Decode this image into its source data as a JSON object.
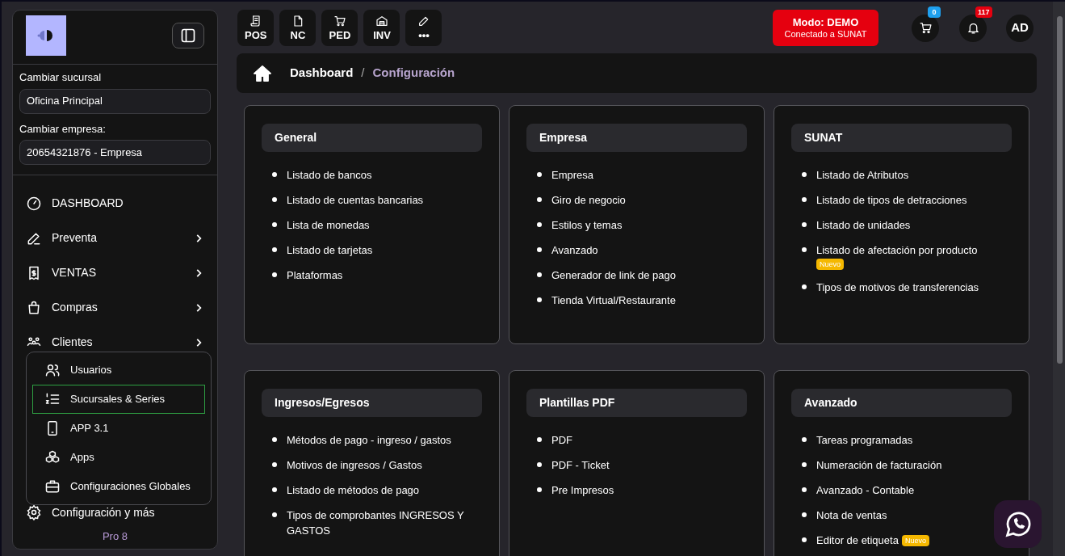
{
  "sidebar": {
    "sucursal_label": "Cambiar sucursal",
    "sucursal_value": "Oficina Principal",
    "empresa_label": "Cambiar empresa:",
    "empresa_value": "20654321876 - Empresa",
    "menu": [
      {
        "label": "DASHBOARD",
        "has_submenu": false
      },
      {
        "label": "Preventa",
        "has_submenu": true
      },
      {
        "label": "VENTAS",
        "has_submenu": true
      },
      {
        "label": "Compras",
        "has_submenu": true
      },
      {
        "label": "Clientes",
        "has_submenu": true
      }
    ],
    "submenu": [
      {
        "label": "Usuarios",
        "selected": false
      },
      {
        "label": "Sucursales & Series",
        "selected": true
      },
      {
        "label": "APP 3.1",
        "selected": false
      },
      {
        "label": "Apps",
        "selected": false
      },
      {
        "label": "Configuraciones Globales",
        "selected": false
      }
    ],
    "settings_item": "Configuración y más",
    "version": "Pro 8"
  },
  "toolbar": [
    {
      "label": "POS"
    },
    {
      "label": "NC"
    },
    {
      "label": "PED"
    },
    {
      "label": "INV"
    },
    {
      "label": "•••"
    }
  ],
  "mode_badge": {
    "title": "Modo: DEMO",
    "subtitle": "Conectado a SUNAT"
  },
  "cart_count": "0",
  "notification_count": "117",
  "avatar": "AD",
  "breadcrumb": [
    "Dashboard",
    "Configuración"
  ],
  "breadcrumb_separator": "/",
  "cards": [
    {
      "title": "General",
      "items": [
        {
          "text": "Listado de bancos"
        },
        {
          "text": "Listado de cuentas bancarias"
        },
        {
          "text": "Lista de monedas"
        },
        {
          "text": "Listado de tarjetas"
        },
        {
          "text": "Plataformas"
        }
      ]
    },
    {
      "title": "Empresa",
      "items": [
        {
          "text": "Empresa"
        },
        {
          "text": "Giro de negocio"
        },
        {
          "text": "Estilos y temas"
        },
        {
          "text": "Avanzado"
        },
        {
          "text": "Generador de link de pago"
        },
        {
          "text": "Tienda Virtual/Restaurante"
        }
      ]
    },
    {
      "title": "SUNAT",
      "items": [
        {
          "text": "Listado de Atributos"
        },
        {
          "text": "Listado de tipos de detracciones"
        },
        {
          "text": "Listado de unidades"
        },
        {
          "text": "Listado de afectación por producto",
          "badge": "Nuevo",
          "badge_newline": true
        },
        {
          "text": "Tipos de motivos de transferencias"
        }
      ]
    },
    {
      "title": "Ingresos/Egresos",
      "items": [
        {
          "text": "Métodos de pago - ingreso / gastos"
        },
        {
          "text": "Motivos de ingresos / Gastos"
        },
        {
          "text": "Listado de métodos de pago"
        },
        {
          "text": "Tipos de comprobantes INGRESOS Y GASTOS"
        }
      ]
    },
    {
      "title": "Plantillas PDF",
      "items": [
        {
          "text": "PDF"
        },
        {
          "text": "PDF - Ticket"
        },
        {
          "text": "Pre Impresos"
        }
      ]
    },
    {
      "title": "Avanzado",
      "items": [
        {
          "text": "Tareas programadas"
        },
        {
          "text": "Numeración de facturación"
        },
        {
          "text": "Avanzado - Contable"
        },
        {
          "text": "Nota de ventas"
        },
        {
          "text": "Editor de etiqueta",
          "badge": "Nuevo",
          "badge_newline": false
        }
      ]
    }
  ]
}
